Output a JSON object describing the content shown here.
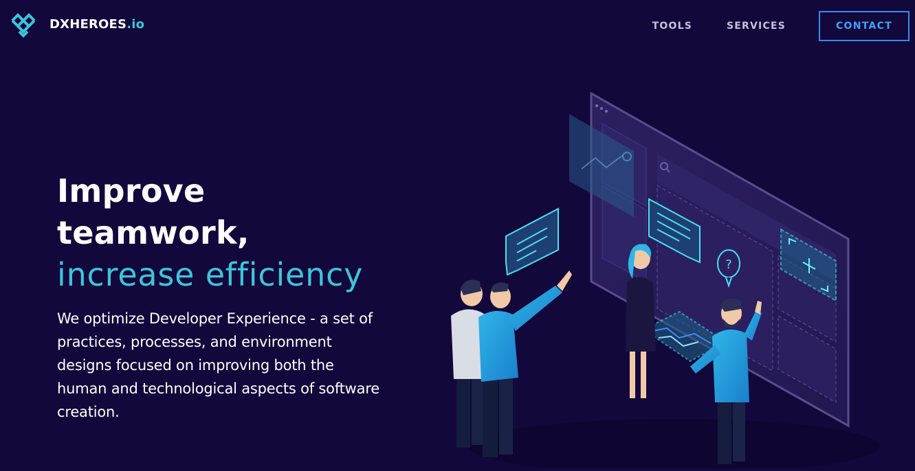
{
  "brand": {
    "name_main": "DXHEROES",
    "name_suffix": ".io"
  },
  "nav": {
    "items": [
      "TOOLS",
      "SERVICES"
    ],
    "cta_label": "CONTACT"
  },
  "hero": {
    "headline_line1": "Improve",
    "headline_line2": "teamwork,",
    "headline_line3": "increase efficiency",
    "description": "We optimize Developer Experience - a set of practices, processes, and environment designs focused on improving both the human and technological aspects of software creation.",
    "bubble_question_mark": "?"
  },
  "colors": {
    "background": "#13083b",
    "accent": "#3cc6da",
    "cta": "#2f8ef0",
    "nav_text": "#c7c3d8"
  },
  "icons": [
    "dxheroes-logo-icon",
    "search-icon",
    "image-icon",
    "expand-icon",
    "question-icon",
    "chart-icon"
  ]
}
